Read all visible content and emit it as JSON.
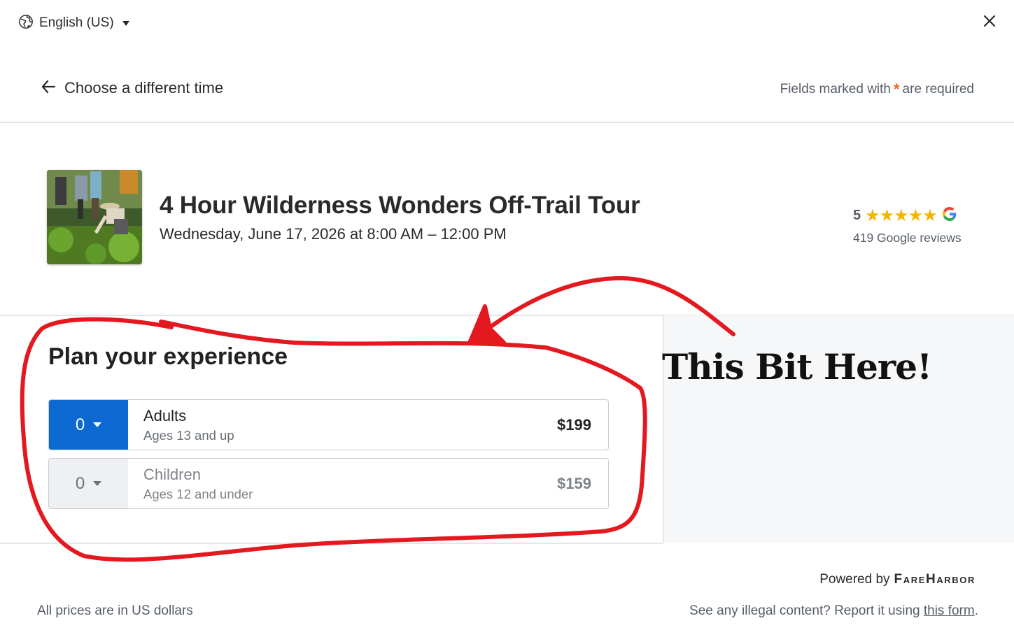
{
  "header": {
    "language_label": "English (US)",
    "close_symbol": "×"
  },
  "nav": {
    "back_label": "Choose a different time",
    "required_prefix": "Fields marked with",
    "required_star": "*",
    "required_suffix": "are required"
  },
  "tour": {
    "title": "4 Hour Wilderness Wonders Off-Trail Tour",
    "datetime": "Wednesday, June 17, 2026 at 8:00 AM – 12:00 PM",
    "rating_value": "5",
    "stars": "★★★★★",
    "reviews": "419 Google reviews"
  },
  "plan": {
    "title": "Plan your experience",
    "rows": [
      {
        "qty": "0",
        "name": "Adults",
        "ages": "Ages 13 and up",
        "price": "$199"
      },
      {
        "qty": "0",
        "name": "Children",
        "ages": "Ages 12 and under",
        "price": "$159"
      }
    ]
  },
  "annotation": {
    "text": "This Bit Here!",
    "color": "#e4191f"
  },
  "footer": {
    "powered_by": "Powered by",
    "brand": "FareHarbor",
    "prices_note": "All prices are in US dollars",
    "report_text": "See any illegal content? Report it using",
    "report_link": "this form",
    "report_end": "."
  },
  "colors": {
    "accent_blue": "#0b69d1",
    "required_orange": "#f26522",
    "star_gold": "#f4b400"
  },
  "icons": [
    "globe-icon",
    "dropdown-caret-icon",
    "close-icon",
    "back-arrow-icon",
    "google-g-icon"
  ]
}
